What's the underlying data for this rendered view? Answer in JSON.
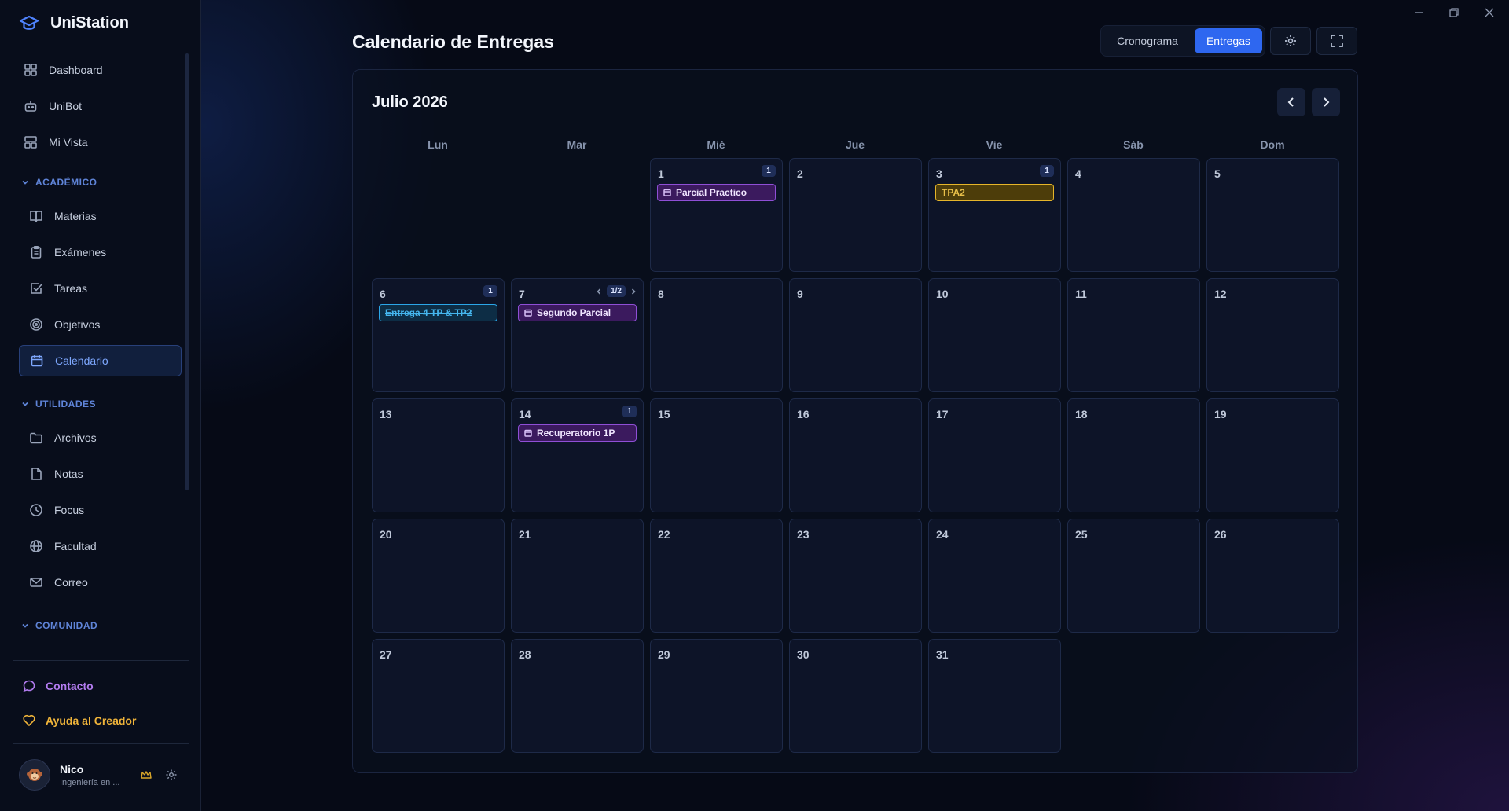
{
  "app": {
    "name": "UniStation"
  },
  "sidebar": {
    "top_items": [
      {
        "label": "Dashboard",
        "icon": "dashboard-icon"
      },
      {
        "label": "UniBot",
        "icon": "bot-icon"
      },
      {
        "label": "Mi Vista",
        "icon": "layout-icon"
      }
    ],
    "sections": [
      {
        "label": "ACADÉMICO",
        "items": [
          {
            "label": "Materias",
            "icon": "book-icon"
          },
          {
            "label": "Exámenes",
            "icon": "clipboard-icon"
          },
          {
            "label": "Tareas",
            "icon": "checkbox-icon"
          },
          {
            "label": "Objetivos",
            "icon": "target-icon"
          },
          {
            "label": "Calendario",
            "icon": "calendar-icon",
            "active": true
          }
        ]
      },
      {
        "label": "UTILIDADES",
        "items": [
          {
            "label": "Archivos",
            "icon": "folder-icon"
          },
          {
            "label": "Notas",
            "icon": "file-icon"
          },
          {
            "label": "Focus",
            "icon": "clock-icon"
          },
          {
            "label": "Facultad",
            "icon": "globe-icon"
          },
          {
            "label": "Correo",
            "icon": "mail-icon"
          }
        ]
      },
      {
        "label": "COMUNIDAD",
        "items": []
      }
    ],
    "contact_label": "Contacto",
    "help_label": "Ayuda al Creador",
    "user": {
      "name": "Nico",
      "subtitle": "Ingeniería en ..."
    }
  },
  "header": {
    "title": "Calendario de Entregas",
    "view_toggle": {
      "options": [
        "Cronograma",
        "Entregas"
      ],
      "selected": "Entregas"
    }
  },
  "calendar": {
    "month_label": "Julio 2026",
    "weekdays": [
      "Lun",
      "Mar",
      "Mié",
      "Jue",
      "Vie",
      "Sáb",
      "Dom"
    ],
    "first_weekday_index": 2,
    "days_in_month": 31,
    "events": [
      {
        "day": 1,
        "count": "1",
        "title": "Parcial Practico",
        "style": "purple"
      },
      {
        "day": 3,
        "count": "1",
        "title": "TPA2",
        "style": "yellow"
      },
      {
        "day": 6,
        "count": "1",
        "title": "Entrega 4 TP & TP2",
        "style": "cyan"
      },
      {
        "day": 7,
        "pager": "1/2",
        "title": "Segundo Parcial",
        "style": "purple"
      },
      {
        "day": 14,
        "count": "1",
        "title": "Recuperatorio 1P",
        "style": "purple"
      }
    ]
  },
  "colors": {
    "accent": "#2e67f0",
    "active_nav": "#7ea8ff",
    "event_purple": "#8f4fd6",
    "event_yellow": "#e5b52a",
    "event_cyan": "#2ba6e8"
  }
}
